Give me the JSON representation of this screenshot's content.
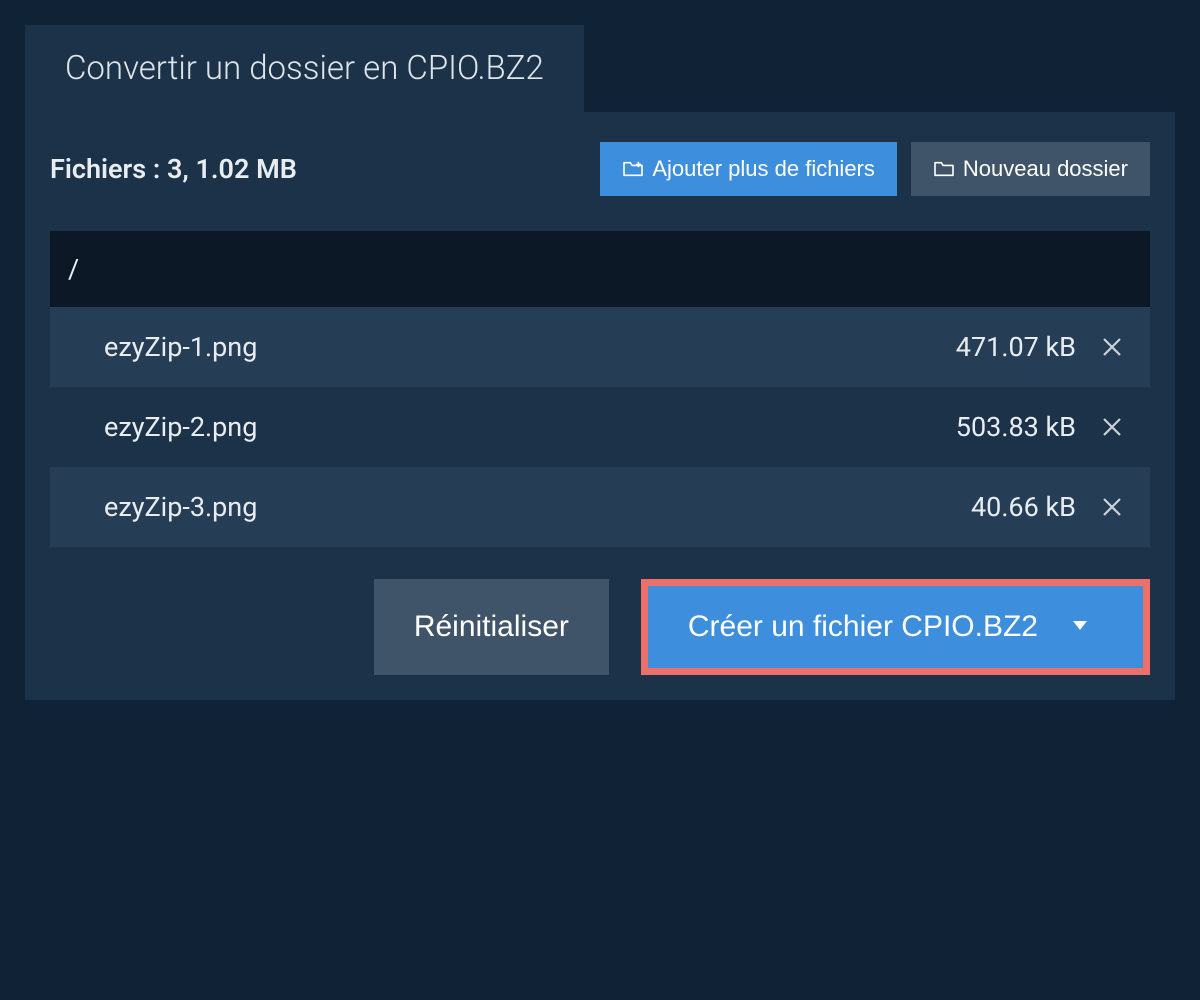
{
  "tab_title": "Convertir un dossier en CPIO.BZ2",
  "summary": {
    "label": "Fichiers :",
    "count": "3",
    "size": "1.02 MB"
  },
  "toolbar": {
    "add_files_label": "Ajouter plus de fichiers",
    "new_folder_label": "Nouveau dossier"
  },
  "path": "/",
  "files": [
    {
      "name": "ezyZip-1.png",
      "size": "471.07 kB"
    },
    {
      "name": "ezyZip-2.png",
      "size": "503.83 kB"
    },
    {
      "name": "ezyZip-3.png",
      "size": "40.66 kB"
    }
  ],
  "actions": {
    "reset_label": "Réinitialiser",
    "create_label": "Créer un fichier CPIO.BZ2"
  }
}
